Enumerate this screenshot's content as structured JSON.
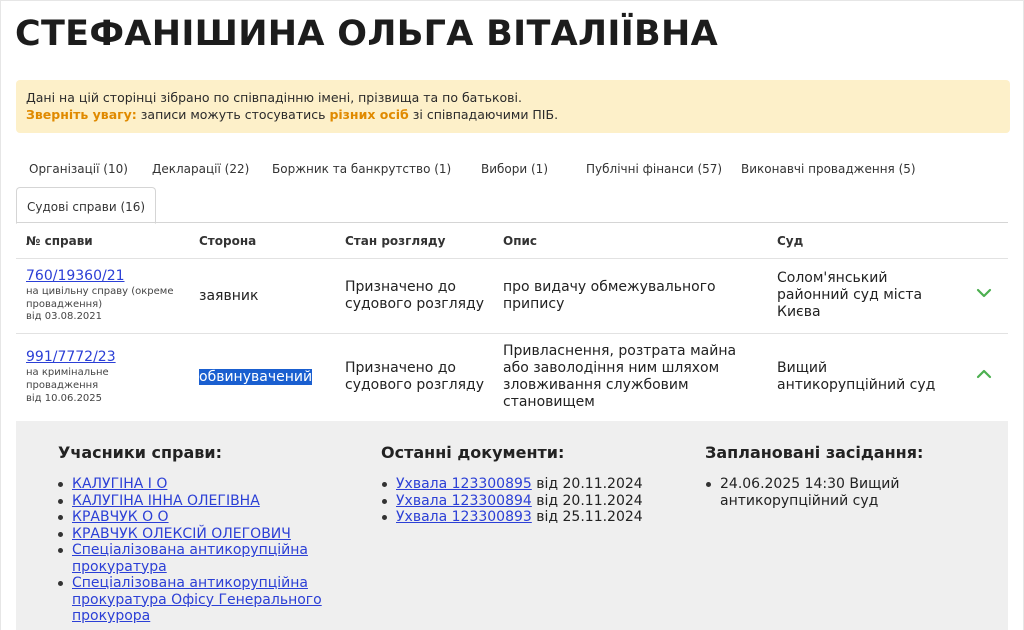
{
  "page_title": "СТЕФАНІШИНА ОЛЬГА ВІТАЛІЇВНА",
  "notice": {
    "line1": "Дані на цій сторінці зібрано по співпадінню імені, прізвища та по батькові.",
    "warn_label": "Зверніть увагу:",
    "line2_a": " записи можуть стосуватись ",
    "line2_highlight": "різних осіб",
    "line2_b": " зі співпадаючими ПІБ."
  },
  "tabs": [
    {
      "label": "Організації (10)"
    },
    {
      "label": "Декларації (22)"
    },
    {
      "label": "Боржник та банкрутство (1)"
    },
    {
      "label": "Вибори (1)"
    },
    {
      "label": "Публічні фінанси (57)"
    },
    {
      "label": "Виконавчі провадження (5)"
    },
    {
      "label": "Судові справи (16)",
      "active": true
    }
  ],
  "table": {
    "headers": [
      "№ справи",
      "Сторона",
      "Стан розгляду",
      "Опис",
      "Суд"
    ],
    "rows": [
      {
        "case_number": "760/19360/21",
        "case_type": "на цивільну справу (окреме провадження)",
        "case_date": "від 03.08.2021",
        "side": "заявник",
        "status": "Призначено до судового розгляду",
        "description": "про видачу обмежувального припису",
        "court": "Солом'янський районний суд міста Києва",
        "expanded": false
      },
      {
        "case_number": "991/7772/23",
        "case_type": "на кримінальне провадження",
        "case_date": "від 10.06.2025",
        "side": "обвинувачений",
        "status": "Призначено до судового розгляду",
        "description": "Привласнення, розтрата майна або заволодіння ним шляхом зловживання службовим становищем",
        "court": "Вищий антикорупційний суд",
        "expanded": true
      }
    ]
  },
  "details": {
    "participants_title": "Учасники справи:",
    "participants": [
      "КАЛУГІНА І О",
      "КАЛУГІНА ІННА ОЛЕГІВНА",
      "КРАВЧУК О О",
      "КРАВЧУК ОЛЕКСІЙ ОЛЕГОВИЧ",
      "Спеціалізована антикорупційна прокуратура",
      "Спеціалізована антикорупційна прокуратура Офісу Генерального прокурора"
    ],
    "documents_title": "Останні документи:",
    "documents": [
      {
        "link": "Ухвала 123300895",
        "date": " від 20.11.2024"
      },
      {
        "link": "Ухвала 123300894",
        "date": " від 20.11.2024"
      },
      {
        "link": "Ухвала 123300893",
        "date": " від 25.11.2024"
      }
    ],
    "hearings_title": "Заплановані засідання:",
    "hearings": [
      "24.06.2025 14:30 Вищий антикорупційний суд"
    ]
  },
  "colors": {
    "link": "#2b3fd6",
    "warning": "#e08a00",
    "notice_bg": "#fdf0c9",
    "chevron": "#4caf50",
    "details_bg": "#efefef"
  }
}
